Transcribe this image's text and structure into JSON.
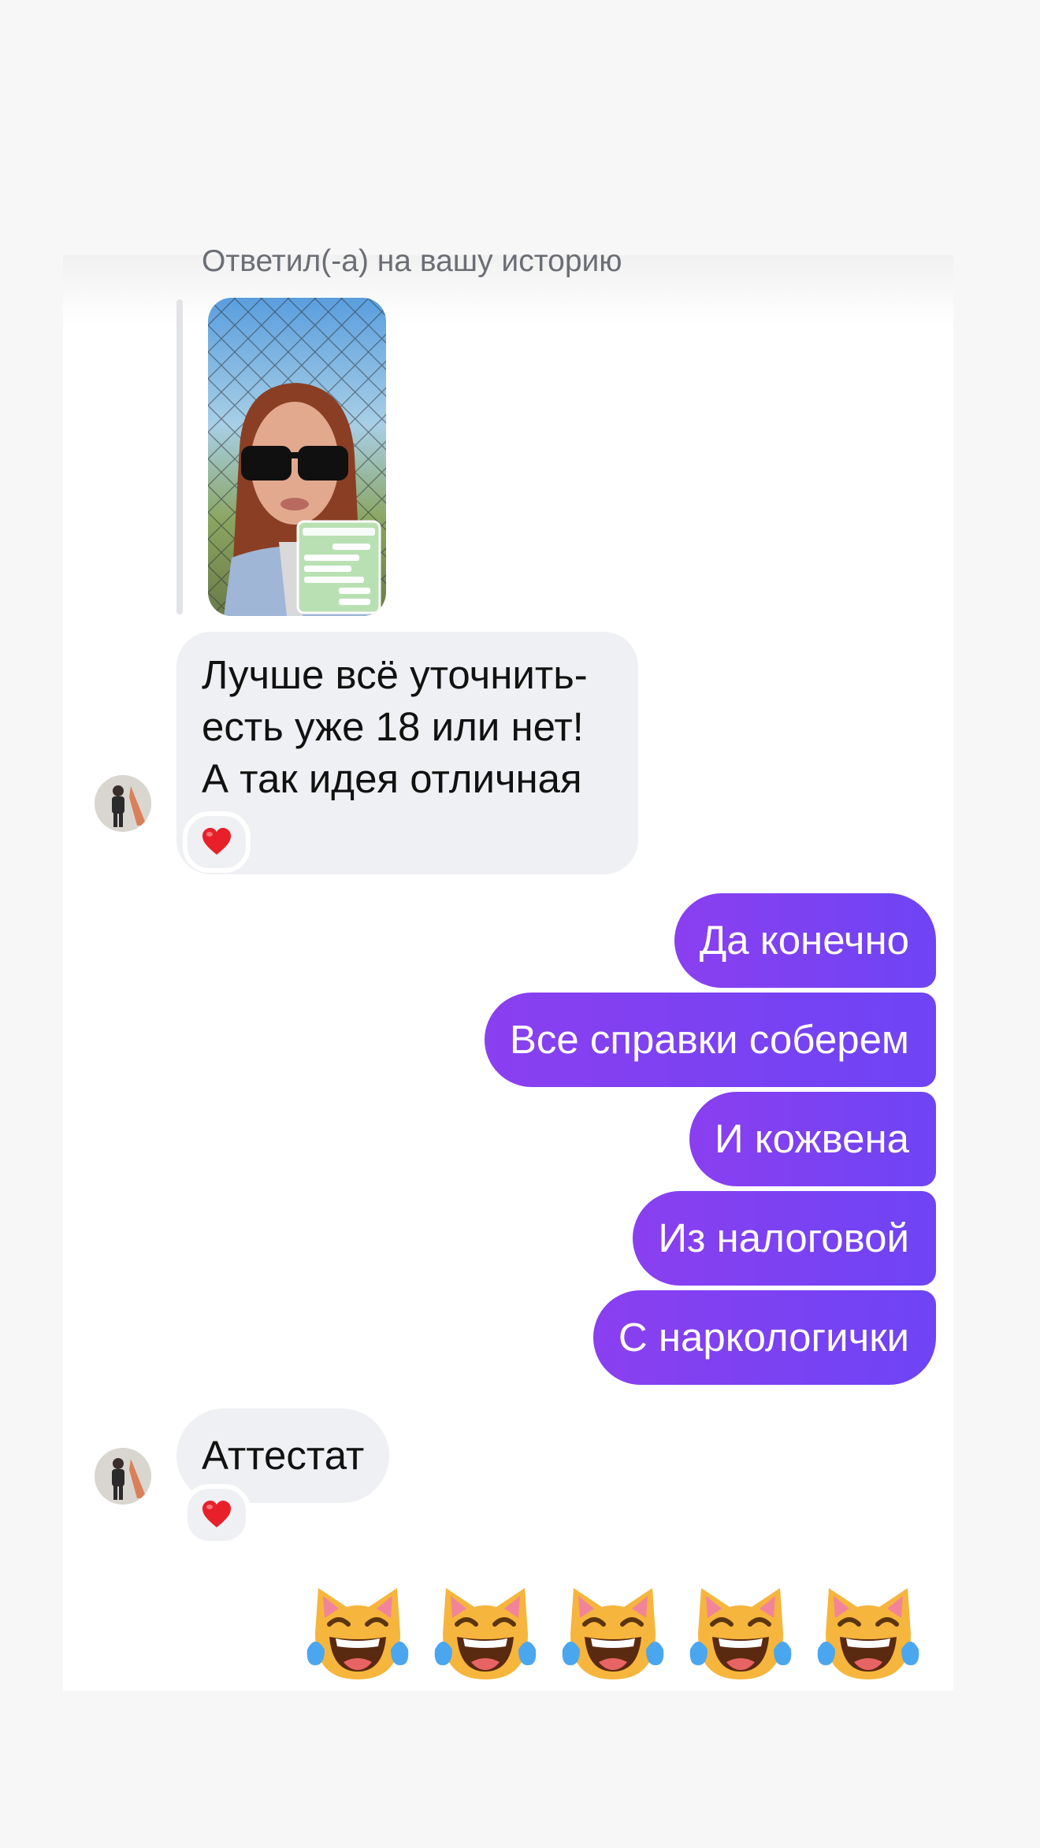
{
  "conversation": {
    "reply_label": "Ответил(-а) на вашу историю",
    "messages": [
      {
        "id": "m1",
        "direction": "incoming",
        "text": "Лучше всё уточнить- есть уже 18 или нет! А так идея отличная 😆",
        "reaction": "❤️"
      },
      {
        "id": "m2",
        "direction": "outgoing",
        "text": "Да конечно"
      },
      {
        "id": "m3",
        "direction": "outgoing",
        "text": "Все справки соберем"
      },
      {
        "id": "m4",
        "direction": "outgoing",
        "text": "И кожвена"
      },
      {
        "id": "m5",
        "direction": "outgoing",
        "text": "Из налоговой"
      },
      {
        "id": "m6",
        "direction": "outgoing",
        "text": "С наркологички"
      },
      {
        "id": "m7",
        "direction": "incoming",
        "text": "Аттестат",
        "reaction": "❤️"
      },
      {
        "id": "m8",
        "direction": "outgoing",
        "text": "😹😹😹😹😹"
      }
    ]
  },
  "icons": {
    "avatar": "user-avatar",
    "story": "story-thumbnail",
    "reaction": "red-heart",
    "big_emoji": "cat-tears-of-joy"
  },
  "colors": {
    "outgoing_bubble": "#7b3cf2",
    "incoming_bubble": "#eff0f3",
    "background": "#ffffff"
  }
}
